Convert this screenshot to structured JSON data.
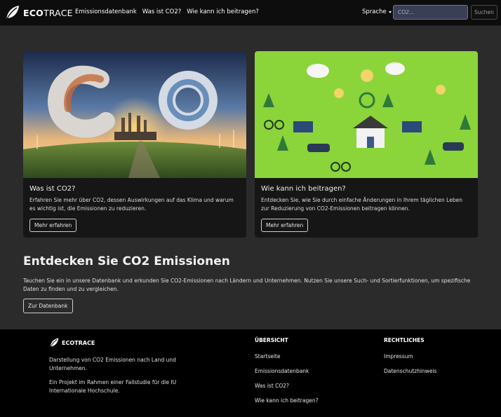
{
  "navbar": {
    "brand_bold": "ECO",
    "brand_rest": "TRACE",
    "links": [
      "Emissionsdatenbank",
      "Was ist CO2?",
      "Wie kann ich beitragen?"
    ],
    "language": "Sprache",
    "search_placeholder": "CO2...",
    "search_button": "Suchen"
  },
  "cards": [
    {
      "title": "Was ist CO2?",
      "text": "Erfahren Sie mehr über CO2, dessen Auswirkungen auf das Klima und warum es wichtig ist, die Emissionen zu reduzieren.",
      "button": "Mehr erfahren"
    },
    {
      "title": "Wie kann ich beitragen?",
      "text": "Entdecken Sie, wie Sie durch einfache Änderungen in Ihrem täglichen Leben zur Reduzierung von CO2-Emissionen beitragen können.",
      "button": "Mehr erfahren"
    }
  ],
  "discover": {
    "title": "Entdecken Sie CO2 Emissionen",
    "text": "Tauchen Sie ein in unsere Datenbank und erkunden Sie CO2-Emissionen nach Ländern und Unternehmen. Nutzen Sie unsere Such- und Sortierfunktionen, um spezifische Daten zu finden und zu vergleichen.",
    "button": "Zur Datenbank"
  },
  "footer": {
    "brand": "ECOTRACE",
    "description": "Darstellung von CO2 Emissionen nach Land und Unternehmen.",
    "project": "Ein Projekt im Rahmen einer Fallstudie für die IU Internationale Hochschule.",
    "overview": {
      "heading": "ÜBERSICHT",
      "links": [
        "Startseite",
        "Emissionsdatenbank",
        "Was ist CO2?",
        "Wie kann ich beitragen?"
      ]
    },
    "legal": {
      "heading": "RECHTLICHES",
      "links": [
        "Impressum",
        "Datenschutzhinweis"
      ]
    }
  },
  "colors": {
    "navbar_bg": "#0d0d0d",
    "page_bg": "#2b2b2b",
    "card_bg": "#161616",
    "footer_bg": "#000000",
    "search_bg": "#3a3f55",
    "accent_green": "#8bd43a"
  },
  "icons": {
    "logo": "leaf-icon",
    "language_caret": "caret-down-icon"
  }
}
